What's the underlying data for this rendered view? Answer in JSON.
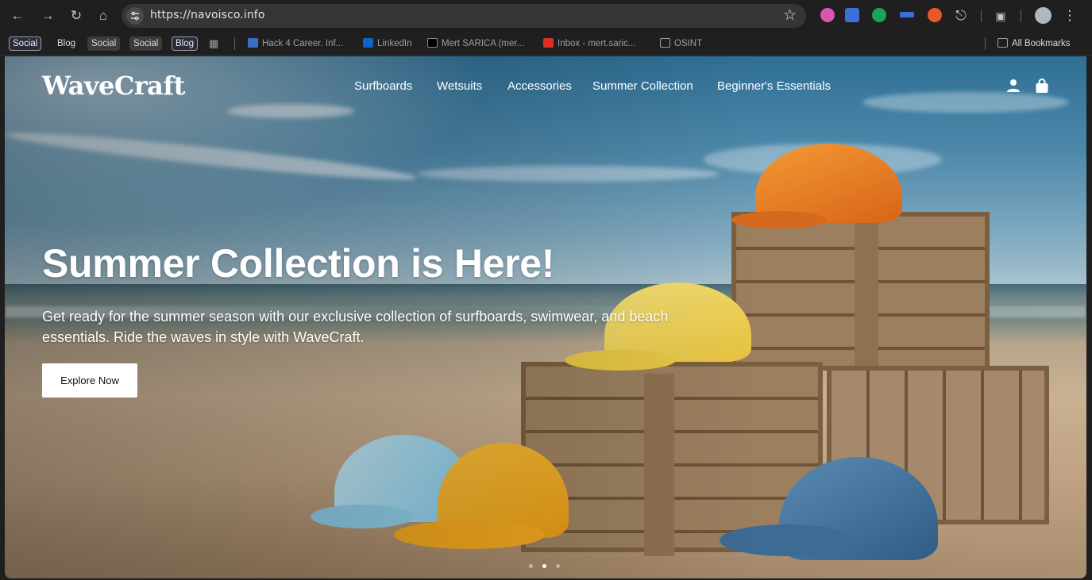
{
  "browser": {
    "url": "https://navoisco.info",
    "nav_icons": {
      "back": "arrow-left-icon",
      "forward": "arrow-right-icon",
      "reload": "reload-icon",
      "home": "home-icon"
    },
    "bookmarks": [
      {
        "label": "Social",
        "style": "outlined"
      },
      {
        "label": "Blog",
        "style": "plain"
      },
      {
        "label": "Social",
        "style": "filled"
      },
      {
        "label": "Social",
        "style": "filled"
      },
      {
        "label": "Blog",
        "style": "outlined"
      },
      {
        "label": "Hack 4 Career. Inf...",
        "style": "plain",
        "icon": "hack4career-icon"
      },
      {
        "label": "LinkedIn",
        "style": "plain",
        "icon": "linkedin-icon"
      },
      {
        "label": "Mert SARICA (mer...",
        "style": "plain",
        "icon": "x-icon"
      },
      {
        "label": "Inbox - mert.saric...",
        "style": "plain",
        "icon": "gmail-icon"
      },
      {
        "label": "OSINT",
        "style": "plain",
        "icon": "folder-icon"
      }
    ],
    "all_bookmarks": "All Bookmarks"
  },
  "site": {
    "logo": "WaveCraft",
    "nav": [
      "Surfboards",
      "Wetsuits",
      "Accessories",
      "Summer Collection",
      "Beginner's Essentials"
    ],
    "header_icons": [
      "user-icon",
      "shopping-bag-icon"
    ]
  },
  "hero": {
    "title": "Summer Collection is Here!",
    "text": "Get ready for the summer season with our exclusive collection of surfboards, swimwear, and beach essentials. Ride the waves in style with WaveCraft.",
    "cta": "Explore Now",
    "slides": 3,
    "active_slide": 2
  },
  "colors": {
    "chrome_bg": "#1f1f1f",
    "omnibox_bg": "#333537",
    "cta_bg": "#ffffff",
    "hero_text": "#ffffff"
  }
}
